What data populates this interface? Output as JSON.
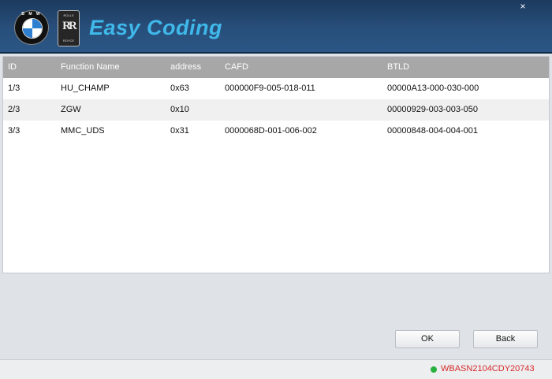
{
  "header": {
    "bmw_logo_text": "B M W",
    "rr_logo_top": "ROLLS",
    "rr_logo_letters": "RR",
    "rr_logo_bottom": "ROYCE",
    "brand": "Easy Coding",
    "close_glyph": "×"
  },
  "table": {
    "columns": [
      "ID",
      "Function Name",
      "address",
      "CAFD",
      "BTLD"
    ],
    "rows": [
      [
        "1/3",
        "HU_CHAMP",
        "0x63",
        "000000F9-005-018-011",
        "00000A13-000-030-000"
      ],
      [
        "2/3",
        "ZGW",
        "0x10",
        "",
        "00000929-003-003-050"
      ],
      [
        "3/3",
        "MMC_UDS",
        "0x31",
        "0000068D-001-006-002",
        "00000848-004-004-001"
      ]
    ]
  },
  "buttons": {
    "ok": "OK",
    "back": "Back"
  },
  "status": {
    "vin": "WBASN2104CDY20743",
    "indicator_color": "#27b13f"
  }
}
